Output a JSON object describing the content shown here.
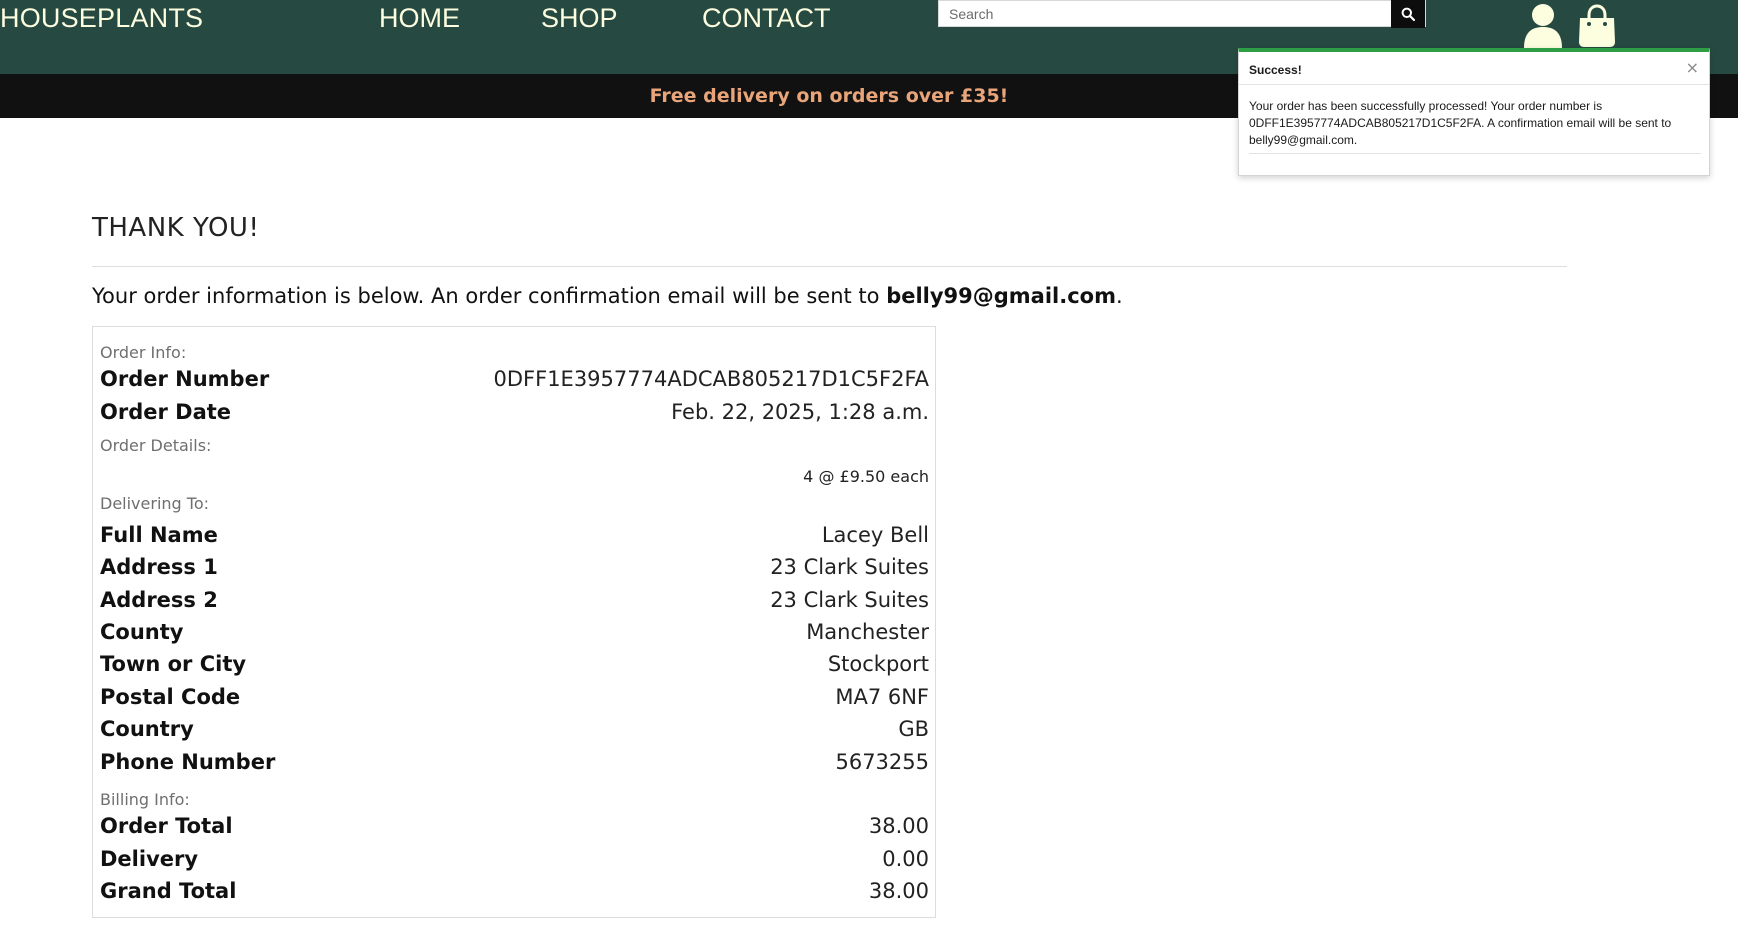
{
  "header": {
    "brand": "HOUSEPLANTS",
    "nav": {
      "home": "HOME",
      "shop": "SHOP",
      "contact": "CONTACT"
    },
    "search": {
      "placeholder": "Search",
      "icon": "search-icon"
    },
    "account_icon": "user-icon",
    "bag_icon": "shopping-bag-icon"
  },
  "banner": {
    "text": "Free delivery on orders over £35!"
  },
  "toast": {
    "title": "Success!",
    "close": "×",
    "message": "Your order has been successfully processed! Your order number is 0DFF1E3957774ADCAB805217D1C5F2FA. A confirmation email will be sent to belly99@gmail.com."
  },
  "page": {
    "title": "THANK YOU!",
    "intro_prefix": "Your order information is below. An order confirmation email will be sent to ",
    "email": "belly99@gmail.com",
    "intro_suffix": "."
  },
  "order": {
    "order_info_label": "Order Info:",
    "order_number_label": "Order Number",
    "order_number": "0DFF1E3957774ADCAB805217D1C5F2FA",
    "order_date_label": "Order Date",
    "order_date": "Feb. 22, 2025, 1:28 a.m.",
    "order_details_label": "Order Details:",
    "line_item": "4 @ £9.50 each",
    "delivering_to_label": "Delivering To:",
    "full_name_label": "Full Name",
    "full_name": "Lacey Bell",
    "address1_label": "Address 1",
    "address1": "23 Clark Suites",
    "address2_label": "Address 2",
    "address2": "23 Clark Suites",
    "county_label": "County",
    "county": "Manchester",
    "town_label": "Town or City",
    "town": "Stockport",
    "postal_label": "Postal Code",
    "postal": "MA7 6NF",
    "country_label": "Country",
    "country": "GB",
    "phone_label": "Phone Number",
    "phone": "5673255",
    "billing_info_label": "Billing Info:",
    "order_total_label": "Order Total",
    "order_total": "38.00",
    "delivery_label": "Delivery",
    "delivery": "0.00",
    "grand_total_label": "Grand Total",
    "grand_total": "38.00"
  },
  "colors": {
    "header_bg": "#264a41",
    "header_text": "#fdfde0",
    "banner_bg": "#111111",
    "banner_text": "#e9a57a",
    "toast_accent": "#2e9e45"
  }
}
